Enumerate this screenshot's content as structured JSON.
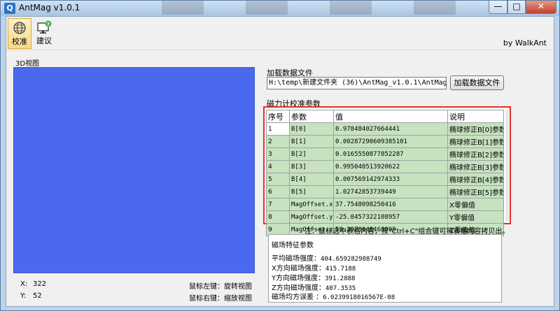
{
  "window": {
    "title": "AntMag v1.0.1",
    "icon_glyph": "Q",
    "min_glyph": "—",
    "max_glyph": "□",
    "close_glyph": "✕"
  },
  "toolbar": {
    "calibrate_label": "校准",
    "suggest_label": "建议",
    "byline": "by WalkAnt"
  },
  "view": {
    "label": "3D视图",
    "background_color": "#4a69ee",
    "x_label": "X:",
    "x_value": "322",
    "y_label": "Y:",
    "y_value": "52",
    "left_hint": "鼠标左键：旋转视图",
    "right_hint": "鼠标右键：缩放视图"
  },
  "load": {
    "label": "加载数据文件",
    "path": "H:\\temp\\新建文件夹 (36)\\AntMag_v1.0.1\\AntMag_v1.0.1\\",
    "button": "加载数据文件"
  },
  "params": {
    "label": "磁力计校准参数",
    "headers": {
      "idx": "序号",
      "name": "参数",
      "value": "值",
      "note": "说明"
    },
    "rows": [
      {
        "idx": "1",
        "name": "B[0]",
        "value": "0.978484027664441",
        "note": "椭球修正B[0]参数"
      },
      {
        "idx": "2",
        "name": "B[1]",
        "value": "0.00287290609385101",
        "note": "椭球修正B[1]参数"
      },
      {
        "idx": "3",
        "name": "B[2]",
        "value": "0.0165550877852287",
        "note": "椭球修正B[2]参数"
      },
      {
        "idx": "4",
        "name": "B[3]",
        "value": "0.995040513920622",
        "note": "椭球修正B[3]参数"
      },
      {
        "idx": "5",
        "name": "B[4]",
        "value": "0.007569142974333",
        "note": "椭球修正B[4]参数"
      },
      {
        "idx": "6",
        "name": "B[5]",
        "value": "1.02742853739449",
        "note": "椭球修正B[5]参数"
      },
      {
        "idx": "7",
        "name": "MagOffset.x",
        "value": "37.7548098250416",
        "note": "X零偏值"
      },
      {
        "idx": "8",
        "name": "MagOffset.y",
        "value": "-25.0457322108957",
        "note": "Y零偏值"
      },
      {
        "idx": "9",
        "name": "MagOffset.z",
        "value": "59.2978048468999",
        "note": "Z零偏值"
      }
    ],
    "note": "注：鼠标选中表格内容，按\"Ctrl+C\"组合键可将表格内容拷贝出。"
  },
  "stats": {
    "title": "磁场特征参数",
    "rows": [
      {
        "label": "平均磁场强度：",
        "value": "404.659282988749"
      },
      {
        "label": "X方向磁场强度：",
        "value": "415.7188"
      },
      {
        "label": "Y方向磁场强度：",
        "value": "391.2888"
      },
      {
        "label": "Z方向磁场强度：",
        "value": "407.3535"
      },
      {
        "label": "磁场均方误差 ：",
        "value": "6.0239918016567E-08"
      }
    ]
  },
  "colors": {
    "highlight_border": "#e0302a",
    "cell_green": "#c6e2c0"
  }
}
